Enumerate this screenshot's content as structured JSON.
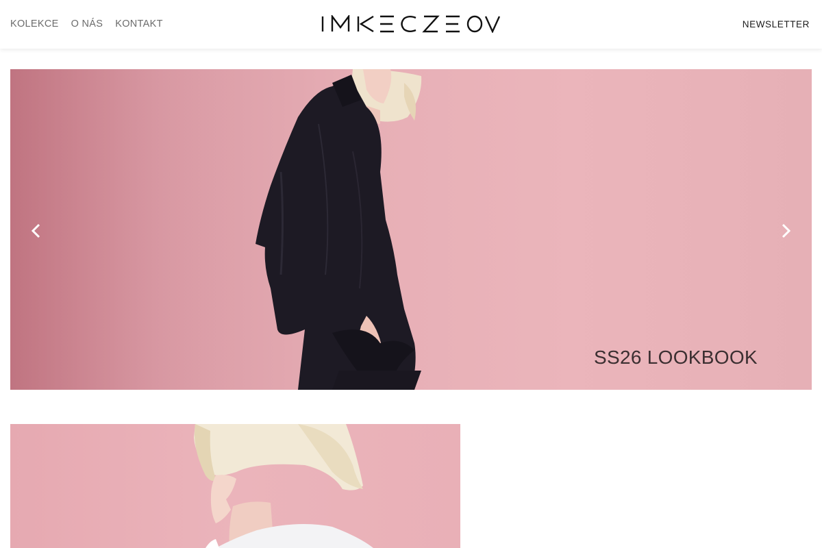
{
  "header": {
    "nav": [
      {
        "label": "KOLEKCE"
      },
      {
        "label": "O NÁS"
      },
      {
        "label": "KONTAKT"
      }
    ],
    "logo_text": "IMRECZEOVA",
    "newsletter_label": "NEWSLETTER"
  },
  "hero": {
    "caption": "SS26 LOOKBOOK",
    "prev_icon": "chevron-left-icon",
    "next_icon": "chevron-right-icon"
  },
  "colors": {
    "background": "#ffffff",
    "hero_pink": "#e9b2b8",
    "hero_pink_dark": "#c97f8b",
    "nav_text": "#6b6b6b",
    "caption_text": "#3b2f31",
    "garment": "#1d1a24",
    "hair": "#efe2c8"
  }
}
